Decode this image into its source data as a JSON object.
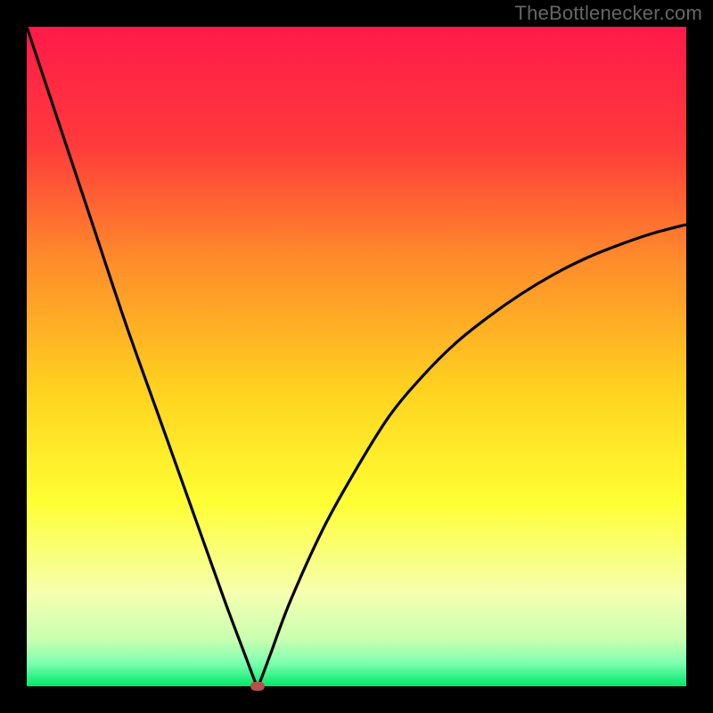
{
  "watermark": "TheBottlenecker.com",
  "chart_data": {
    "type": "line",
    "title": "",
    "xlabel": "",
    "ylabel": "",
    "xlim": [
      0,
      100
    ],
    "ylim": [
      0,
      100
    ],
    "x_minimum": 35,
    "series": [
      {
        "name": "bottleneck-curve",
        "x": [
          0,
          5,
          10,
          15,
          20,
          25,
          30,
          33,
          34.5,
          35,
          35.5,
          37,
          40,
          45,
          50,
          55,
          60,
          65,
          70,
          75,
          80,
          85,
          90,
          95,
          100
        ],
        "values": [
          100,
          85,
          70,
          55,
          41,
          27,
          13,
          5,
          1,
          0,
          1,
          5,
          13,
          24,
          33,
          41,
          47,
          52,
          56,
          59.5,
          62.5,
          65,
          67,
          68.7,
          70
        ]
      }
    ],
    "background_gradient": {
      "stops": [
        {
          "pos": 0.0,
          "color": "#ff1a4a"
        },
        {
          "pos": 0.18,
          "color": "#ff3b3b"
        },
        {
          "pos": 0.35,
          "color": "#ff8a2b"
        },
        {
          "pos": 0.55,
          "color": "#ffd21f"
        },
        {
          "pos": 0.72,
          "color": "#ffff33"
        },
        {
          "pos": 0.86,
          "color": "#f5ffb0"
        },
        {
          "pos": 0.93,
          "color": "#c8ffb0"
        },
        {
          "pos": 0.965,
          "color": "#7dffb0"
        },
        {
          "pos": 1.0,
          "color": "#00e86b"
        }
      ]
    },
    "curve_stroke": "#000000",
    "curve_width": 3.2,
    "marker_color": "#b0544a"
  },
  "plot_geometry": {
    "outer_w": 800,
    "outer_h": 800,
    "inner_left": 30,
    "inner_top": 30,
    "inner_w": 740,
    "inner_h": 740
  }
}
